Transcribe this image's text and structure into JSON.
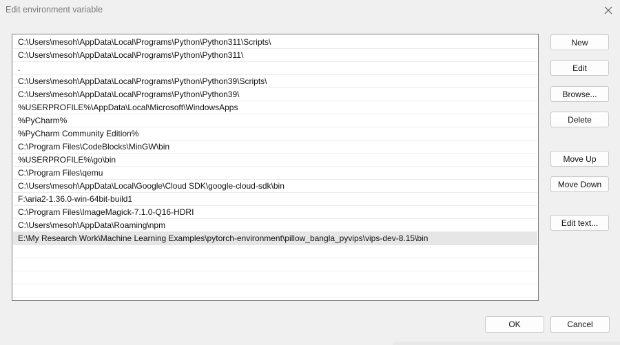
{
  "window": {
    "title": "Edit environment variable",
    "close_icon": "close-icon"
  },
  "path_list": {
    "items": [
      "C:\\Users\\mesoh\\AppData\\Local\\Programs\\Python\\Python311\\Scripts\\",
      "C:\\Users\\mesoh\\AppData\\Local\\Programs\\Python\\Python311\\",
      ".",
      "C:\\Users\\mesoh\\AppData\\Local\\Programs\\Python\\Python39\\Scripts\\",
      "C:\\Users\\mesoh\\AppData\\Local\\Programs\\Python\\Python39\\",
      "%USERPROFILE%\\AppData\\Local\\Microsoft\\WindowsApps",
      "%PyCharm%",
      "%PyCharm Community Edition%",
      "C:\\Program Files\\CodeBlocks\\MinGW\\bin",
      "%USERPROFILE%\\go\\bin",
      "C:\\Program Files\\qemu",
      "C:\\Users\\mesoh\\AppData\\Local\\Google\\Cloud SDK\\google-cloud-sdk\\bin",
      "F:\\aria2-1.36.0-win-64bit-build1",
      "C:\\Program Files\\ImageMagick-7.1.0-Q16-HDRI",
      "C:\\Users\\mesoh\\AppData\\Roaming\\npm",
      "E:\\My Research Work\\Machine Learning Examples\\pytorch-environment\\pillow_bangla_pyvips\\vips-dev-8.15\\bin",
      "",
      "",
      "",
      ""
    ],
    "selected_index": 15
  },
  "side_buttons": {
    "new": "New",
    "edit": "Edit",
    "browse": "Browse...",
    "delete": "Delete",
    "move_up": "Move Up",
    "move_down": "Move Down",
    "edit_text": "Edit text..."
  },
  "footer": {
    "ok": "OK",
    "cancel": "Cancel"
  }
}
